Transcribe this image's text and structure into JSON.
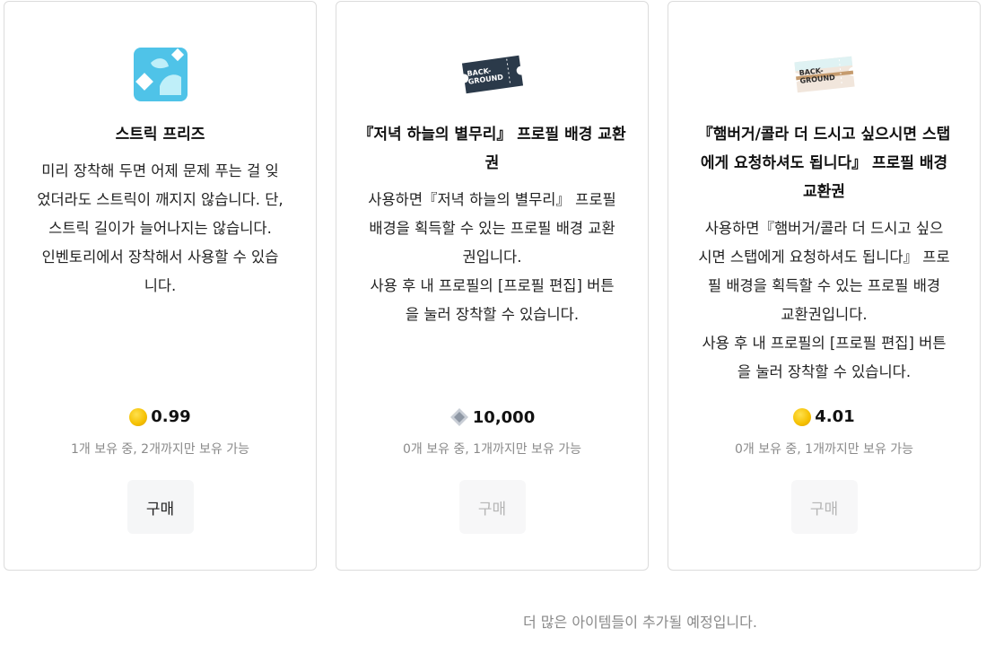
{
  "items": [
    {
      "title_lines": [
        "스트릭 프리즈"
      ],
      "desc_lines": [
        "미리 장착해 두면 어제 문제 푸는 걸 잊",
        "었더라도 스트릭이 깨지지 않습니다. 단,",
        "스트릭 길이가 늘어나지는 않습니다.",
        "인벤토리에서 장착해서 사용할 수 있습",
        "니다."
      ],
      "price": "0.99",
      "currency_icon": "coin-icon",
      "owned": "1개 보유 중, 2개까지만 보유 가능",
      "buy_label": "구매",
      "buy_enabled": true
    },
    {
      "title_lines": [
        "『저녁 하늘의 별무리』 프로필 배경 교환",
        "권"
      ],
      "desc_lines": [
        "사용하면『저녁 하늘의 별무리』 프로필",
        "배경을 획득할 수 있는 프로필 배경 교환",
        "권입니다.",
        "사용 후 내 프로필의 [프로필 편집] 버튼",
        "을 눌러 장착할 수 있습니다."
      ],
      "icon_text_1": "BACK-",
      "icon_text_2": "GROUND",
      "price": "10,000",
      "currency_icon": "diamond-icon",
      "owned": "0개 보유 중, 1개까지만 보유 가능",
      "buy_label": "구매",
      "buy_enabled": false
    },
    {
      "title_lines": [
        "『햄버거/콜라 더 드시고 싶으시면 스탭",
        "에게 요청하셔도 됩니다』 프로필 배경",
        "교환권"
      ],
      "desc_lines": [
        "사용하면『햄버거/콜라 더 드시고 싶으",
        "시면 스탭에게 요청하셔도 됩니다』 프로",
        "필 배경을 획득할 수 있는 프로필 배경",
        "교환권입니다.",
        "사용 후 내 프로필의 [프로필 편집] 버튼",
        "을 눌러 장착할 수 있습니다."
      ],
      "icon_text_1": "BACK-",
      "icon_text_2": "GROUND",
      "price": "4.01",
      "currency_icon": "coin-icon",
      "owned": "0개 보유 중, 1개까지만 보유 가능",
      "buy_label": "구매",
      "buy_enabled": false
    }
  ],
  "footer_text": "더 많은 아이템들이 추가될 예정입니다.",
  "colors": {
    "coin": "#f5c000",
    "freeze_icon": "#4fc3e8",
    "ticket_dark": "#2b3a4a",
    "ticket_light": "#f1e6dc"
  }
}
